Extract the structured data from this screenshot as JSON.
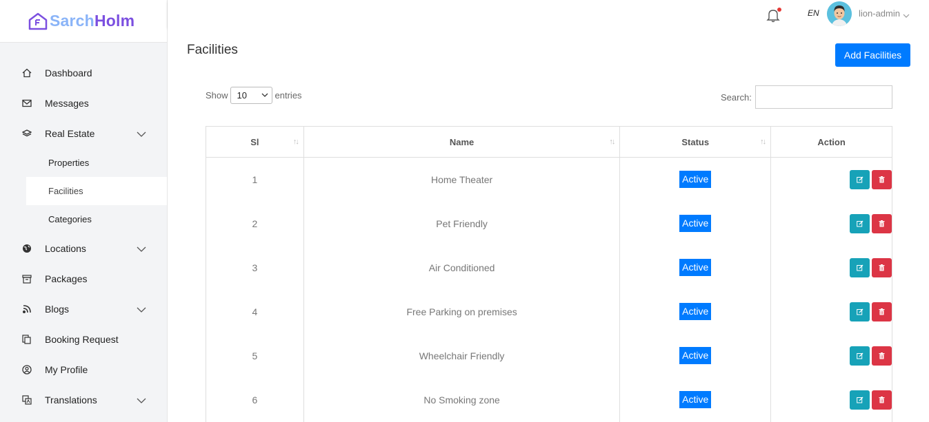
{
  "brand": {
    "part1": "Sarch",
    "part2": "Holm"
  },
  "sidebar": {
    "items": [
      {
        "label": "Dashboard",
        "icon": "home-icon"
      },
      {
        "label": "Messages",
        "icon": "mail-icon"
      },
      {
        "label": "Real Estate",
        "icon": "layers-icon",
        "expandable": true
      },
      {
        "label": "Locations",
        "icon": "globe-icon",
        "expandable": true
      },
      {
        "label": "Packages",
        "icon": "archive-icon"
      },
      {
        "label": "Blogs",
        "icon": "rss-icon",
        "expandable": true
      },
      {
        "label": "Booking Request",
        "icon": "copy-icon"
      },
      {
        "label": "My Profile",
        "icon": "user-circle-icon"
      },
      {
        "label": "Translations",
        "icon": "translate-icon",
        "expandable": true
      }
    ],
    "real_estate_sub": [
      "Properties",
      "Facilities",
      "Categories"
    ],
    "active_sub": "Facilities"
  },
  "topbar": {
    "lang": "EN",
    "username": "lion-admin"
  },
  "page": {
    "title": "Facilities",
    "add_button": "Add Facilities",
    "show_label": "Show",
    "entries_value": "10",
    "entries_label": "entries",
    "search_label": "Search:",
    "search_value": ""
  },
  "table": {
    "headers": [
      "Sl",
      "Name",
      "Status",
      "Action"
    ],
    "rows": [
      {
        "sl": "1",
        "name": "Home Theater",
        "status": "Active"
      },
      {
        "sl": "2",
        "name": "Pet Friendly",
        "status": "Active"
      },
      {
        "sl": "3",
        "name": "Air Conditioned",
        "status": "Active"
      },
      {
        "sl": "4",
        "name": "Free Parking on premises",
        "status": "Active"
      },
      {
        "sl": "5",
        "name": "Wheelchair Friendly",
        "status": "Active"
      },
      {
        "sl": "6",
        "name": "No Smoking zone",
        "status": "Active"
      }
    ]
  },
  "colors": {
    "primary": "#007bff",
    "edit": "#17a2b8",
    "delete": "#dc3545",
    "brand_light": "#8ab4f8",
    "brand_dark": "#7b4fe0"
  }
}
